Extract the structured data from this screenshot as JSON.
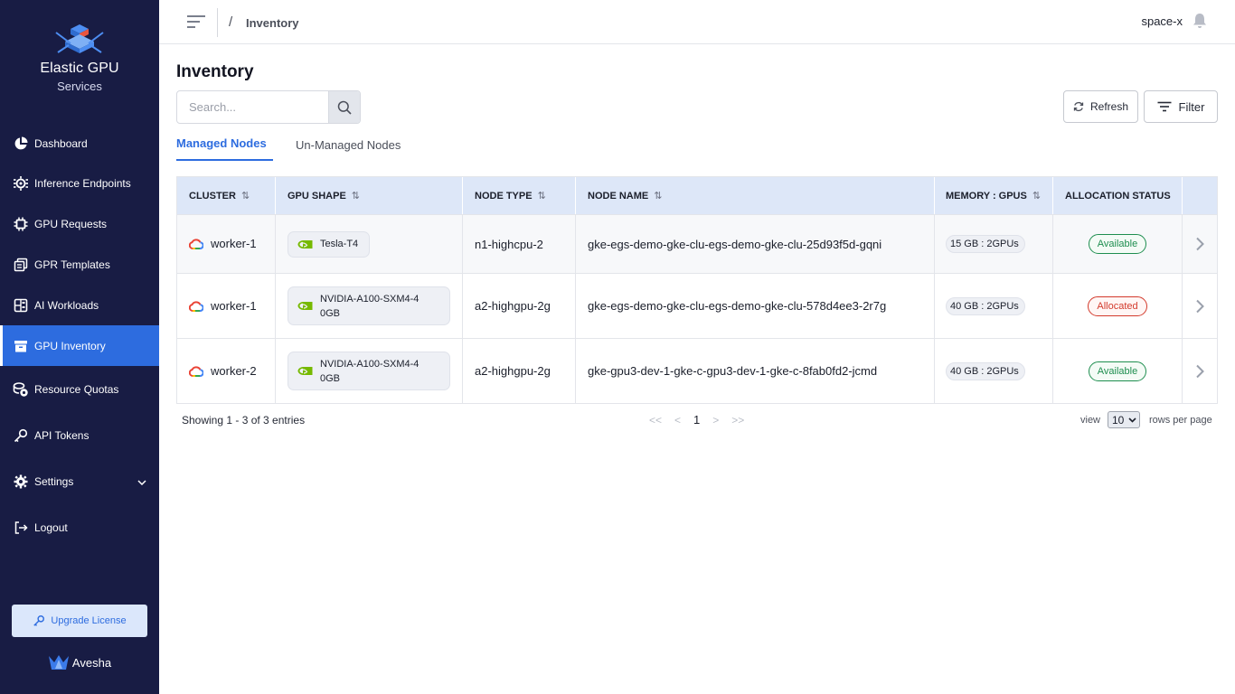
{
  "colors": {
    "sidebar_bg": "#181c44",
    "accent": "#2d6cdf",
    "table_header_bg": "#dde7f8",
    "available": "#1e8e4f",
    "allocated": "#d33a2c"
  },
  "brand": {
    "title": "Elastic GPU",
    "subtitle": "Services",
    "logo_icon": "cube-stack-icon"
  },
  "sidebar": {
    "items": [
      {
        "label": "Dashboard",
        "icon": "pie-chart-icon",
        "active": false
      },
      {
        "label": "Inference Endpoints",
        "icon": "gear-chip-icon",
        "active": false
      },
      {
        "label": "GPU Requests",
        "icon": "chip-icon",
        "active": false
      },
      {
        "label": "GPR Templates",
        "icon": "templates-icon",
        "active": false
      },
      {
        "label": "AI Workloads",
        "icon": "workloads-icon",
        "active": false
      },
      {
        "label": "GPU Inventory",
        "icon": "archive-icon",
        "active": true
      },
      {
        "label": "Resource Quotas",
        "icon": "coins-icon",
        "active": false
      },
      {
        "label": "API Tokens",
        "icon": "key-icon",
        "active": false
      },
      {
        "label": "Settings",
        "icon": "settings-icon",
        "active": false
      },
      {
        "label": "Logout",
        "icon": "logout-icon",
        "active": false
      }
    ],
    "upgrade_label": "Upgrade License",
    "footer_brand": "Avesha"
  },
  "header": {
    "breadcrumb_sep": "/",
    "breadcrumb": "Inventory",
    "user": "space-x"
  },
  "main": {
    "title": "Inventory",
    "search_placeholder": "Search...",
    "refresh_label": "Refresh",
    "filter_label": "Filter",
    "tabs": [
      {
        "label": "Managed Nodes",
        "active": true
      },
      {
        "label": "Un-Managed Nodes",
        "active": false
      }
    ]
  },
  "table": {
    "columns": [
      "CLUSTER",
      "GPU SHAPE",
      "NODE TYPE",
      "NODE NAME",
      "MEMORY : GPUS",
      "ALLOCATION STATUS"
    ],
    "rows": [
      {
        "cluster": "worker-1",
        "gpu_shape": "Tesla-T4",
        "node_type": "n1-highcpu-2",
        "node_name": "gke-egs-demo-gke-clu-egs-demo-gke-clu-25d93f5d-gqni",
        "memory_gpus": "15 GB : 2GPUs",
        "status": "Available"
      },
      {
        "cluster": "worker-1",
        "gpu_shape": "NVIDIA-A100-SXM4-40GB",
        "node_type": "a2-highgpu-2g",
        "node_name": "gke-egs-demo-gke-clu-egs-demo-gke-clu-578d4ee3-2r7g",
        "memory_gpus": "40 GB : 2GPUs",
        "status": "Allocated"
      },
      {
        "cluster": "worker-2",
        "gpu_shape": "NVIDIA-A100-SXM4-40GB",
        "node_type": "a2-highgpu-2g",
        "node_name": "gke-gpu3-dev-1-gke-c-gpu3-dev-1-gke-c-8fab0fd2-jcmd",
        "memory_gpus": "40 GB : 2GPUs",
        "status": "Available"
      }
    ]
  },
  "pagination": {
    "showing": "Showing 1 - 3 of 3 entries",
    "first": "<<",
    "prev": "<",
    "page": "1",
    "next": ">",
    "last": ">>",
    "view_label": "view",
    "rows_per_page": "10",
    "rows_label": "rows per page"
  }
}
